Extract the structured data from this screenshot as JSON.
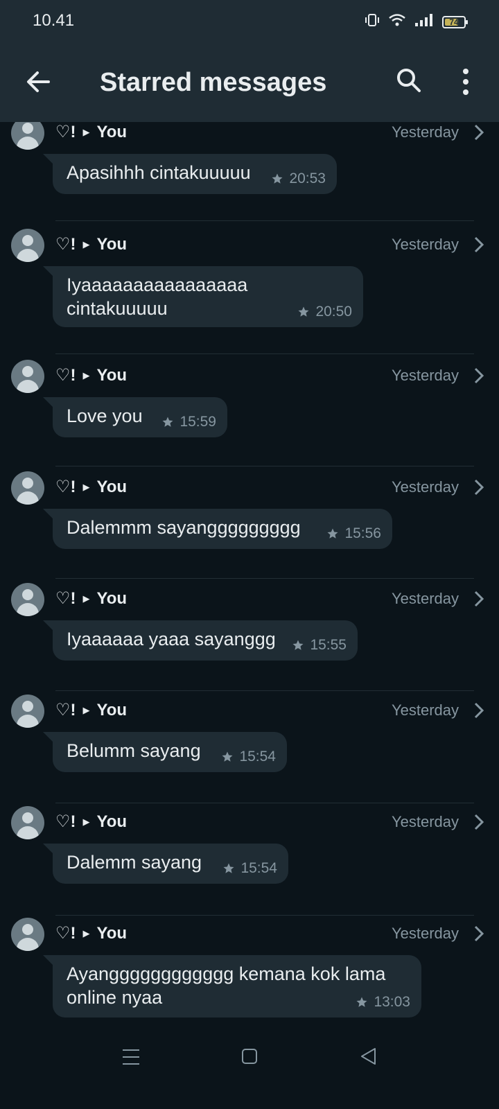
{
  "status": {
    "time": "10.41",
    "battery": "74",
    "battery_level": 0.74,
    "icons": [
      "vibrate-icon",
      "wifi-icon",
      "signal-icon",
      "battery-icon"
    ]
  },
  "appbar": {
    "title": "Starred messages",
    "back_icon": "arrow-left-icon",
    "search_icon": "search-icon",
    "more_icon": "more-vertical-icon"
  },
  "items": [
    {
      "chat": "♡!",
      "to": "You",
      "date": "Yesterday",
      "text": "Apasihhh cintakuuuuu",
      "time": "20:53"
    },
    {
      "chat": "♡!",
      "to": "You",
      "date": "Yesterday",
      "text": "Iyaaaaaaaaaaaaaaaa cintakuuuuu",
      "time": "20:50"
    },
    {
      "chat": "♡!",
      "to": "You",
      "date": "Yesterday",
      "text": "Love you",
      "time": "15:59"
    },
    {
      "chat": "♡!",
      "to": "You",
      "date": "Yesterday",
      "text": "Dalemmm sayanggggggggg",
      "time": "15:56"
    },
    {
      "chat": "♡!",
      "to": "You",
      "date": "Yesterday",
      "text": "Iyaaaaaa yaaa sayanggg",
      "time": "15:55"
    },
    {
      "chat": "♡!",
      "to": "You",
      "date": "Yesterday",
      "text": "Belumm sayang",
      "time": "15:54"
    },
    {
      "chat": "♡!",
      "to": "You",
      "date": "Yesterday",
      "text": "Dalemm sayang",
      "time": "15:54"
    },
    {
      "chat": "♡!",
      "to": "You",
      "date": "Yesterday",
      "text": "Ayangggggggggggg kemana kok lama online nyaa",
      "time": "13:03"
    }
  ],
  "colors": {
    "background": "#0b141a",
    "header": "#1f2c34",
    "bubble": "#1f2c34",
    "text": "#e9edef",
    "muted": "#8696a0"
  }
}
